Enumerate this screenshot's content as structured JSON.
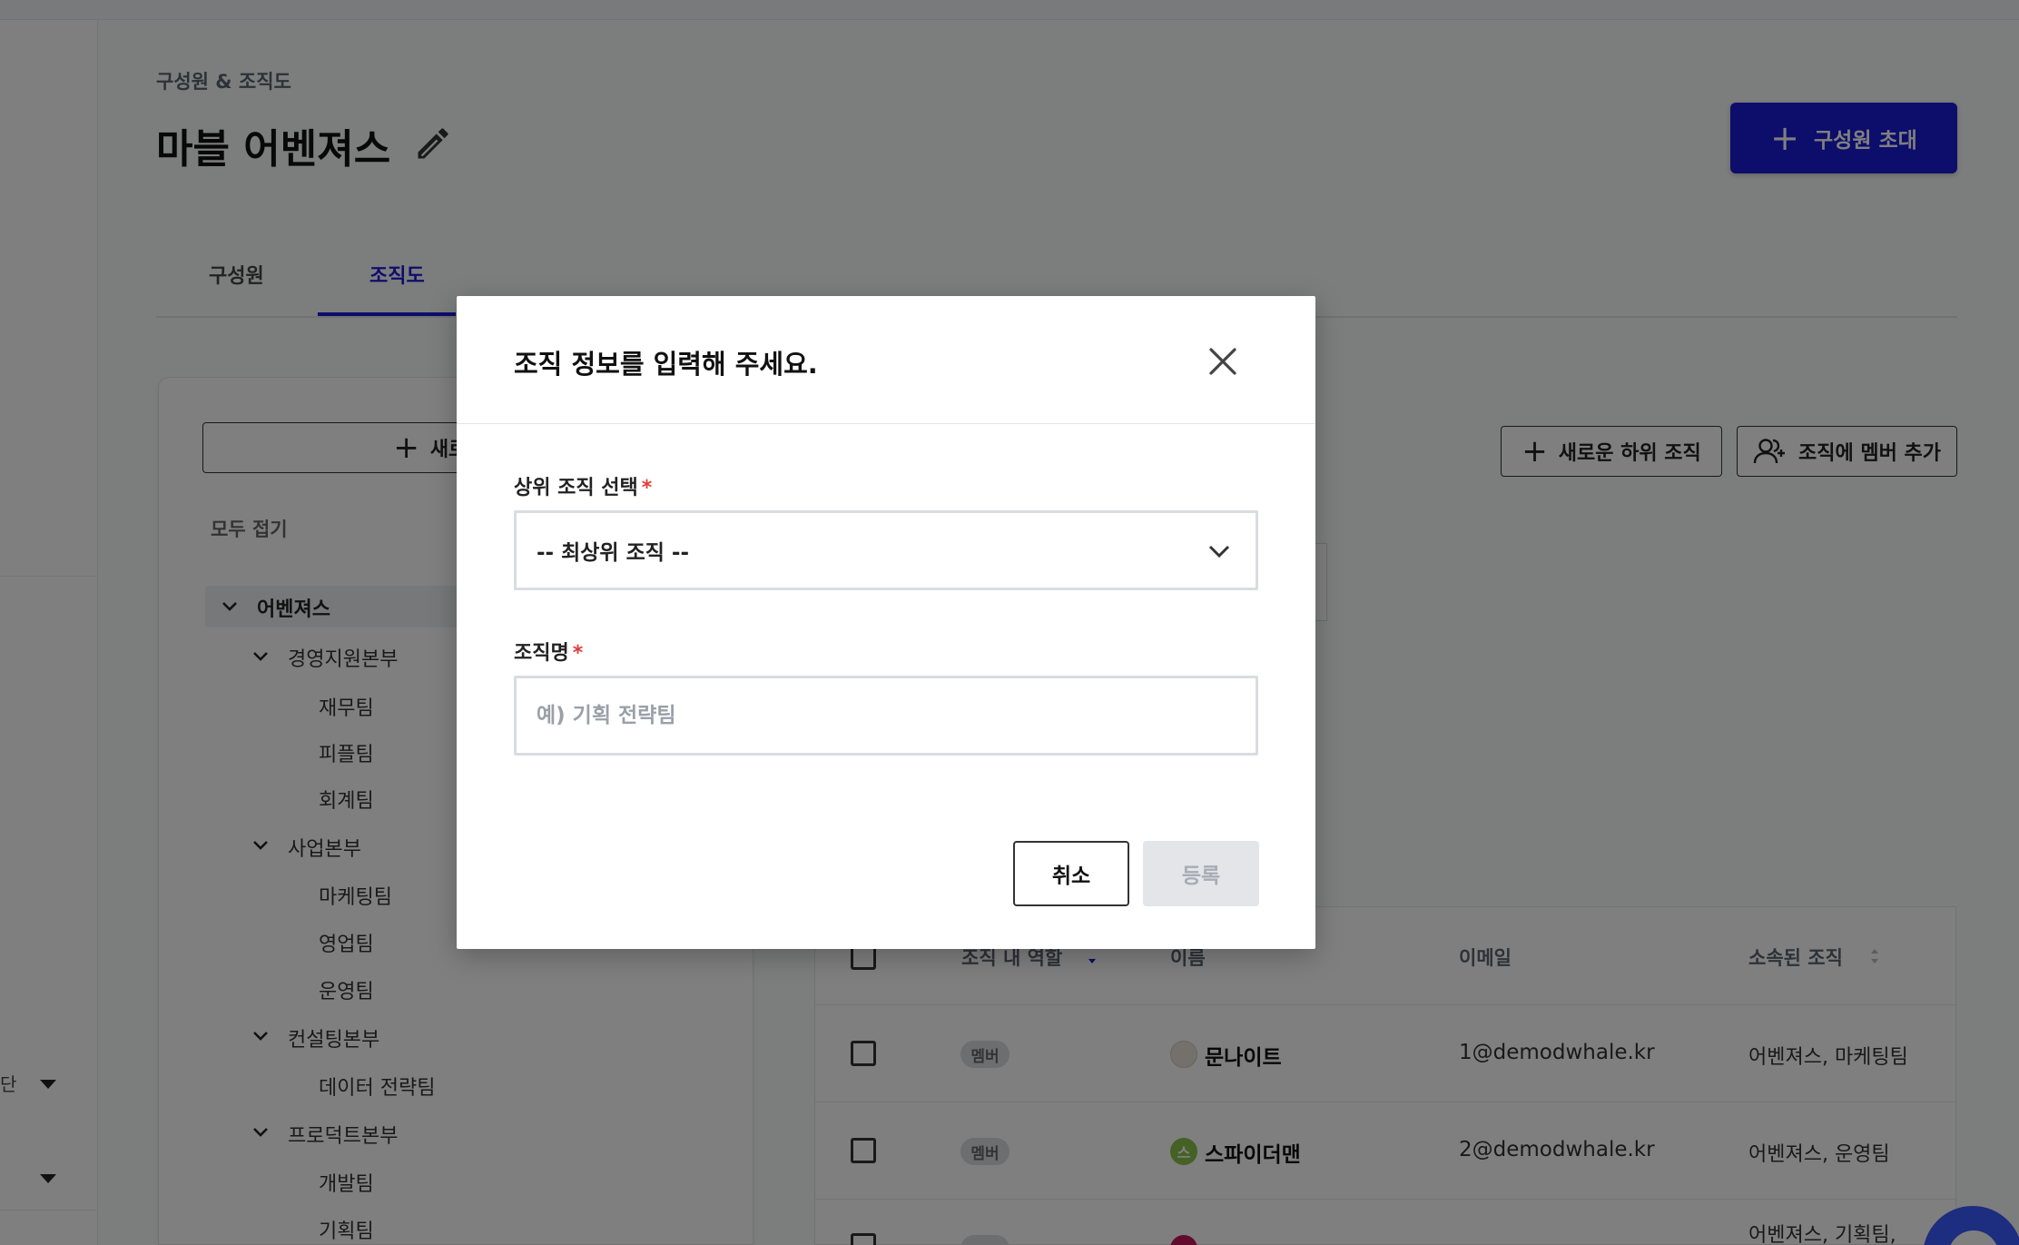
{
  "rail": {
    "item1_text": "단",
    "icons": [
      "caret-down-icon",
      "caret-down-icon"
    ]
  },
  "header": {
    "breadcrumb": "구성원 & 조직도",
    "title": "마블 어벤져스",
    "invite_button": "구성원 초대",
    "icons": {
      "edit": "pencil-icon",
      "invite": "plus-icon"
    },
    "accent_color": "#1a1ad8"
  },
  "tabs": [
    {
      "label": "구성원",
      "active": false
    },
    {
      "label": "조직도",
      "active": true
    }
  ],
  "tree_panel": {
    "new_org_button": "새로운 조직",
    "collapse_all": "모두 접기",
    "root": "어벤져스",
    "groups": [
      {
        "label": "경영지원본부",
        "children": [
          "재무팀",
          "피플팀",
          "회계팀"
        ]
      },
      {
        "label": "사업본부",
        "children": [
          "마케팅팀",
          "영업팀",
          "운영팀"
        ]
      },
      {
        "label": "컨설팅본부",
        "children": [
          "데이터 전략팀"
        ]
      },
      {
        "label": "프로덕트본부",
        "children": [
          "개발팀",
          "기획팀"
        ]
      }
    ]
  },
  "actions": {
    "new_sub_org": "새로운 하위 조직",
    "add_member": "조직에 멤버 추가"
  },
  "table": {
    "headers": {
      "role": "조직 내 역할",
      "name": "이름",
      "email": "이메일",
      "orgs": "소속된 조직"
    },
    "rows": [
      {
        "role": "멤버",
        "avatar_text": "",
        "avatar_color": "#e9e2d8",
        "name": "문나이트",
        "email": "1@demodwhale.kr",
        "orgs": "어벤져스, 마케팅팀"
      },
      {
        "role": "멤버",
        "avatar_text": "스",
        "avatar_color": "#8bc34a",
        "name": "스파이더맨",
        "email": "2@demodwhale.kr",
        "orgs": "어벤져스, 운영팀"
      },
      {
        "role": "",
        "avatar_text": "",
        "avatar_color": "#c2185b",
        "name": "",
        "email": "",
        "orgs": "어벤져스, 기획팀,"
      }
    ]
  },
  "modal": {
    "title": "조직 정보를 입력해 주세요.",
    "parent_label": "상위 조직 선택",
    "parent_value": "-- 최상위 조직 --",
    "name_label": "조직명",
    "name_placeholder": "예) 기획 전략팀",
    "name_value": "",
    "required_mark": "*",
    "cancel": "취소",
    "submit": "등록",
    "icons": {
      "close": "close-icon",
      "select": "chevron-down-icon"
    }
  }
}
